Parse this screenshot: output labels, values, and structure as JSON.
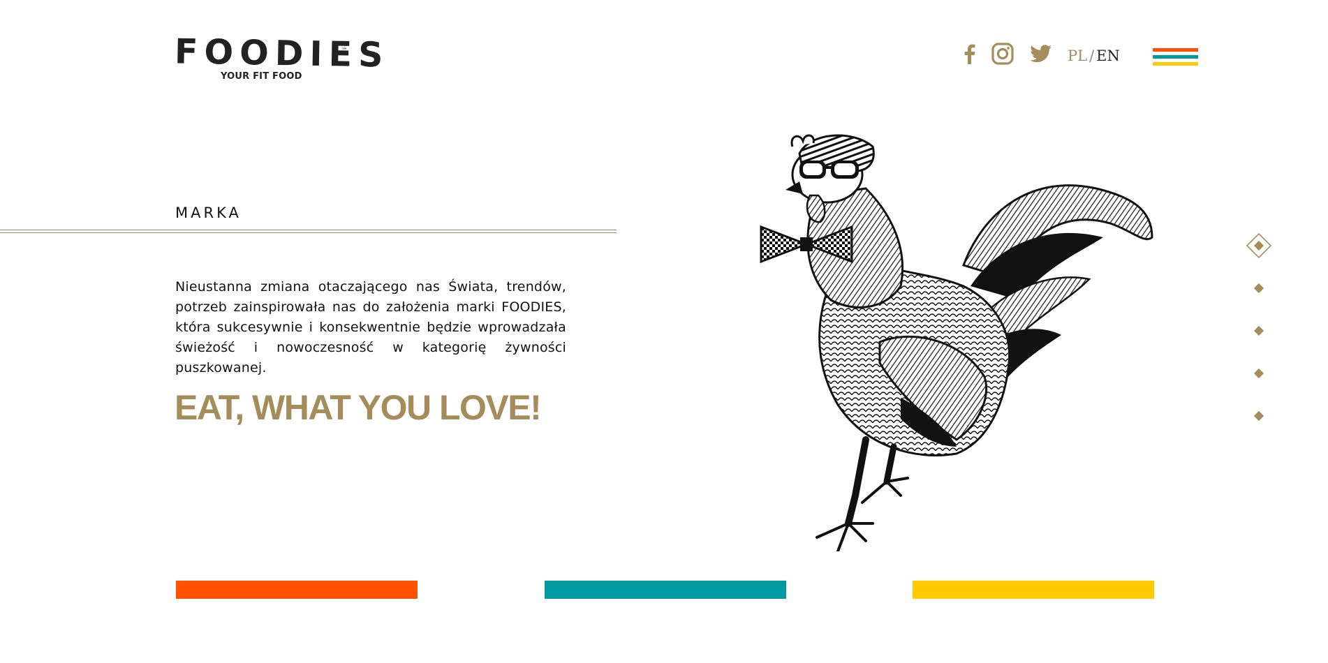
{
  "brand": {
    "name": "FOODIES",
    "trademark": "™",
    "tagline": "YOUR FIT FOOD"
  },
  "header": {
    "social": [
      {
        "icon": "facebook-icon"
      },
      {
        "icon": "instagram-icon"
      },
      {
        "icon": "twitter-icon"
      }
    ],
    "language": {
      "pl": "PL",
      "separator": "/",
      "en": "EN",
      "active": "PL"
    },
    "menu_icon": "hamburger-menu-icon"
  },
  "section": {
    "title": "MARKA",
    "body": "Nieustanna zmiana otaczającego nas Świata, trendów, potrzeb zainspirowała nas do założenia marki FOODIES, która sukcesywnie i konsekwentnie będzie wprowadzała świeżość i nowoczesność w kategorię żywności puszkowanej.",
    "slogan": "EAT, WHAT YOU LOVE!"
  },
  "illustration": {
    "icon": "rooster-illustration"
  },
  "side_nav": {
    "items": 5,
    "active_index": 0
  },
  "colors": {
    "gold": "#a48c5b",
    "orange": "#ff5100",
    "teal": "#00999f",
    "yellow": "#ffcb00",
    "text": "#111111"
  }
}
